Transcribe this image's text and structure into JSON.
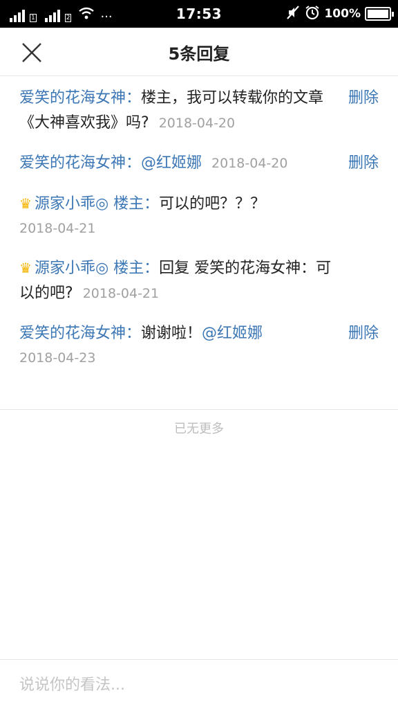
{
  "status_bar": {
    "sim1": "1",
    "sim2": "2",
    "dots": "···",
    "time": "17:53",
    "battery": "100%"
  },
  "header": {
    "title": "5条回复"
  },
  "replies": [
    {
      "author": "爱笑的花海女神：",
      "prefix": "",
      "text": "楼主，我可以转载你的文章《大神喜欢我》吗?",
      "mention": "",
      "date": "2018-04-20",
      "delete_label": "删除"
    },
    {
      "author": "爱笑的花海女神：",
      "prefix": "",
      "text": "",
      "mention": "@红姬娜",
      "date": "2018-04-20",
      "delete_label": "删除"
    },
    {
      "author": "源家小乖◎ 楼主：",
      "prefix": "",
      "text": "可以的吧？？？",
      "mention": "",
      "date": "2018-04-21",
      "delete_label": ""
    },
    {
      "author": "源家小乖◎ 楼主：",
      "prefix": "回复",
      "text": "爱笑的花海女神：可以的吧?",
      "mention": "",
      "date": "2018-04-21",
      "delete_label": ""
    },
    {
      "author": "爱笑的花海女神：",
      "prefix": "",
      "text": "谢谢啦！",
      "mention": "@红姬娜",
      "date": "2018-04-23",
      "delete_label": "删除"
    }
  ],
  "footer_note": "已无更多",
  "input": {
    "placeholder": "说说你的看法..."
  },
  "icons": [
    "signal-icon",
    "wifi-icon",
    "mute-icon",
    "alarm-icon",
    "battery-icon",
    "close-icon",
    "crown-icon"
  ],
  "colors": {
    "link_blue": "#3b76b5",
    "date_gray": "#a0a0a0",
    "crown_gold": "#f5b400"
  }
}
